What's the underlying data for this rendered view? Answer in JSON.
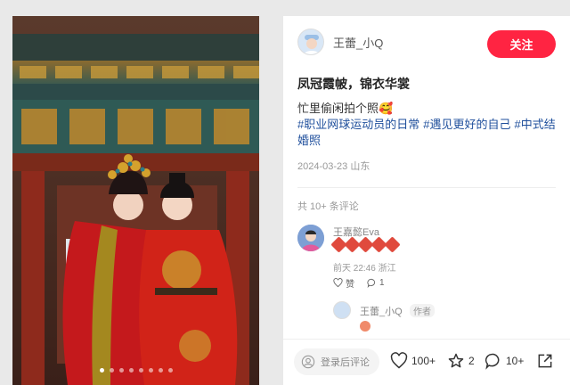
{
  "photo": {
    "dots_total": 8,
    "active_dot": 0
  },
  "author": {
    "name": "王蕾_小Q",
    "follow_label": "关注"
  },
  "post": {
    "title": "凤冠霞帔，锦衣华裳",
    "description": "忙里偷闲拍个照🥰",
    "tags": [
      "#职业网球运动员的日常",
      "#遇见更好的自己",
      "#中式结婚照"
    ],
    "date": "2024-03-23",
    "location": "山东"
  },
  "comments": {
    "count_label": "共 10+ 条评论",
    "items": [
      {
        "name": "王嘉懿Eva",
        "emoji_count": 5,
        "time": "前天 22:46",
        "location": "浙江",
        "like_label": "赞",
        "reply_count": "1"
      }
    ],
    "reply": {
      "name": "王蕾_小Q",
      "badge": "作者"
    }
  },
  "bottom_bar": {
    "input_placeholder": "登录后评论",
    "likes": "100+",
    "collects": "2",
    "comments": "10+"
  },
  "colors": {
    "accent": "#ff2442",
    "tag": "#1f4f9c"
  }
}
